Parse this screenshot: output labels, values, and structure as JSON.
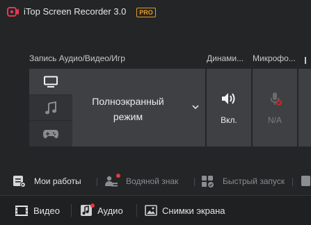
{
  "app": {
    "title": "iTop Screen Recorder 3.0",
    "badge": "PRO"
  },
  "sections": {
    "record_label": "Запись Аудио/Видео/Игр",
    "speaker_label": "Динами...",
    "mic_label": "Микрофо..."
  },
  "record_sources": [
    {
      "icon": "monitor-icon",
      "selected": true
    },
    {
      "icon": "music-note-icon",
      "selected": false
    },
    {
      "icon": "gamepad-icon",
      "selected": false
    }
  ],
  "mode": {
    "line1": "Полноэкранный",
    "line2": "режим"
  },
  "speaker": {
    "status": "Вкл.",
    "icon": "speaker-icon"
  },
  "microphone": {
    "status": "N/A",
    "icon": "microphone-off-icon"
  },
  "toolbar": {
    "my_works": "Мои работы",
    "watermark": "Водяной знак",
    "quick_launch": "Быстрый запуск"
  },
  "tabs": {
    "video": "Видео",
    "audio": "Аудио",
    "screenshots": "Снимки экрана"
  },
  "colors": {
    "accent_red": "#e53935",
    "pro_orange": "#e59b25",
    "background": "#242527"
  }
}
